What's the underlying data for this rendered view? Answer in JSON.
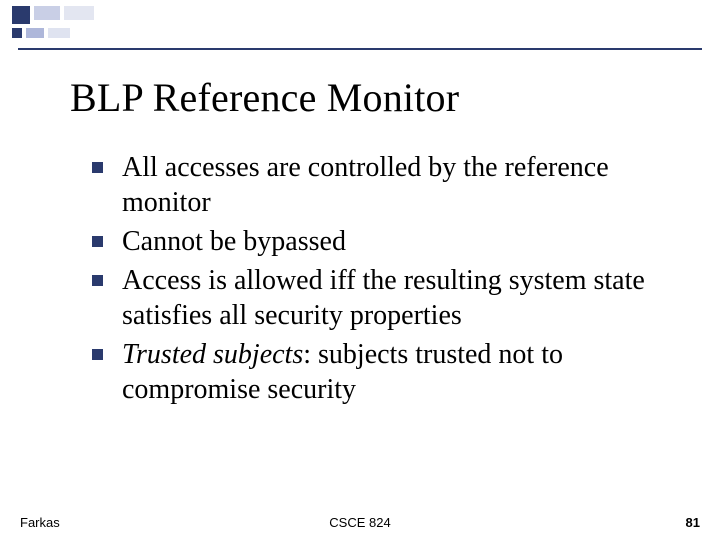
{
  "title": "BLP Reference Monitor",
  "bullets": [
    {
      "runs": [
        {
          "text": "All accesses are controlled by the reference monitor",
          "style": "normal"
        }
      ]
    },
    {
      "runs": [
        {
          "text": "Cannot be bypassed",
          "style": "normal"
        }
      ]
    },
    {
      "runs": [
        {
          "text": "Access is allowed iff the resulting system state satisfies all security properties",
          "style": "normal"
        }
      ]
    },
    {
      "runs": [
        {
          "text": "Trusted subjects",
          "style": "italic"
        },
        {
          "text": ": subjects trusted not to compromise security",
          "style": "normal"
        }
      ]
    }
  ],
  "footer": {
    "left": "Farkas",
    "center": "CSCE 824",
    "right": "81"
  }
}
